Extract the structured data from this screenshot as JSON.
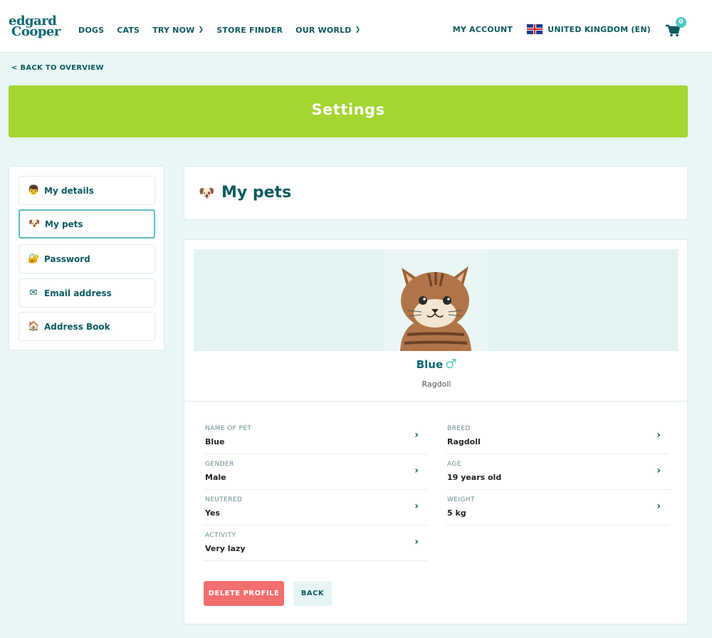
{
  "header": {
    "logo_line1": "edgard",
    "logo_line2": "Cooper",
    "nav": [
      "DOGS",
      "CATS",
      "TRY NOW",
      "STORE FINDER",
      "OUR WORLD"
    ],
    "my_account": "MY ACCOUNT",
    "country": "UNITED KINGDOM (EN)",
    "cart_count": "0"
  },
  "back_link": "< BACK TO OVERVIEW",
  "banner_title": "Settings",
  "sidebar": {
    "items": [
      {
        "label": "My details",
        "icon": "child-face-icon"
      },
      {
        "label": "My pets",
        "icon": "dog-face-icon"
      },
      {
        "label": "Password",
        "icon": "lock-key-icon"
      },
      {
        "label": "Email address",
        "icon": "envelope-icon"
      },
      {
        "label": "Address Book",
        "icon": "house-icon"
      }
    ],
    "active_index": 1
  },
  "main": {
    "title": "My pets",
    "pet": {
      "name": "Blue",
      "gender_symbol": "♂",
      "breed": "Ragdoll"
    },
    "fields_left": [
      {
        "label": "NAME OF PET",
        "value": "Blue"
      },
      {
        "label": "GENDER",
        "value": "Male"
      },
      {
        "label": "NEUTERED",
        "value": "Yes"
      },
      {
        "label": "ACTIVITY",
        "value": "Very lazy"
      }
    ],
    "fields_right": [
      {
        "label": "BREED",
        "value": "Ragdoll"
      },
      {
        "label": "AGE",
        "value": "19 years old"
      },
      {
        "label": "WEIGHT",
        "value": "5 kg"
      }
    ],
    "delete_label": "DELETE PROFILE",
    "back_label": "BACK"
  },
  "colors": {
    "brand_green": "#a4d531",
    "brand_teal": "#0b5a60",
    "delete_red": "#f36e6e",
    "page_bg": "#e8f6f5"
  }
}
